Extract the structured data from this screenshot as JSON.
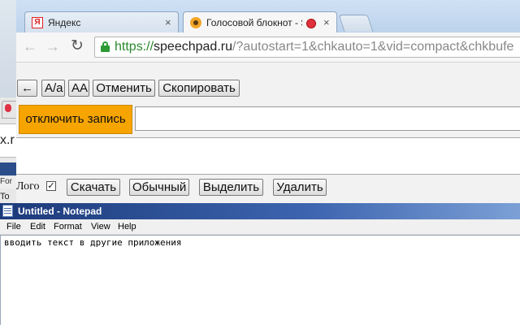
{
  "background_window": {
    "address_fragment": "x.r",
    "menu_fragment": "For",
    "row_fragment": "To"
  },
  "browser": {
    "tabs": [
      {
        "title": "Яндекс",
        "favicon": "yandex-icon",
        "close": "×"
      },
      {
        "title": "Голосовой блокнот - Spe",
        "favicon": "speechpad-icon",
        "close": "×"
      }
    ],
    "nav": {
      "back": "←",
      "forward": "→",
      "reload": "↻"
    },
    "url": {
      "scheme": "https://",
      "host": "speechpad.ru",
      "rest": "/?autostart=1&chkauto=1&vid=compact&chkbufe"
    }
  },
  "speechpad": {
    "toolbar_buttons": [
      "←",
      "A/a",
      "AA",
      "Отменить",
      "Скопировать"
    ],
    "record_button": "отключить запись",
    "logo_label": "Лого",
    "logo_checked": "✓",
    "bottom_buttons": [
      "Скачать",
      "Обычный",
      "Выделить",
      "Удалить"
    ]
  },
  "notepad": {
    "title": "Untitled - Notepad",
    "menu": [
      "File",
      "Edit",
      "Format",
      "View",
      "Help"
    ],
    "text": "вводить текст в другие приложения"
  },
  "colors": {
    "record_button": "#f6a400",
    "notepad_title": "#1c3a7a",
    "url_scheme": "#2a8a2e"
  }
}
